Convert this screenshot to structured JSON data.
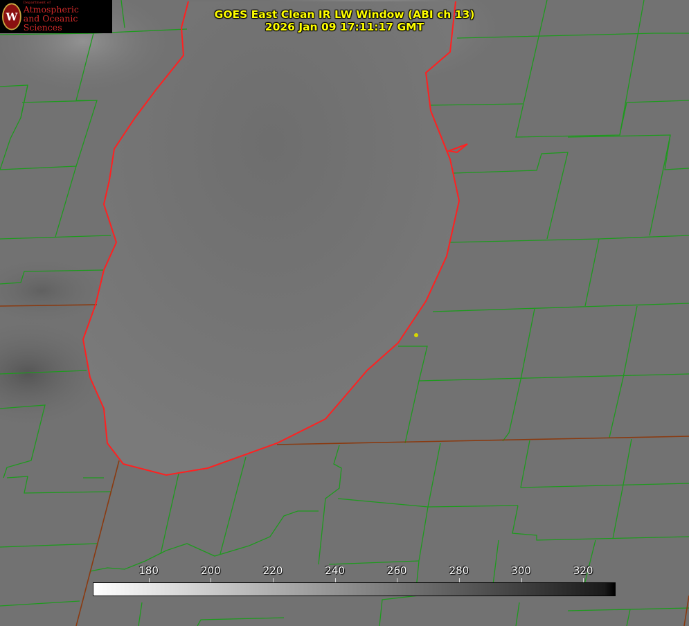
{
  "logo": {
    "dept": "Department of",
    "line1": "Atmospheric",
    "line2": "and Oceanic Sciences",
    "seal_icon": "uw-crest-icon"
  },
  "title": {
    "line1": "GOES East Clean IR LW Window (ABI ch 13)",
    "line2": "2026 Jan 09 17:11:17 GMT"
  },
  "colorbar": {
    "ticks": [
      180,
      200,
      220,
      240,
      260,
      280,
      300,
      320
    ],
    "range": [
      162,
      330
    ],
    "colors": {
      "min": "#ffffff",
      "max": "#000000"
    }
  },
  "colors": {
    "background": "#707070",
    "county_lines": "#1e9a1e",
    "shoreline": "#ff2020",
    "state_lines": "#8a3a10",
    "marker": "#d8d800",
    "title": "#ffff00"
  }
}
